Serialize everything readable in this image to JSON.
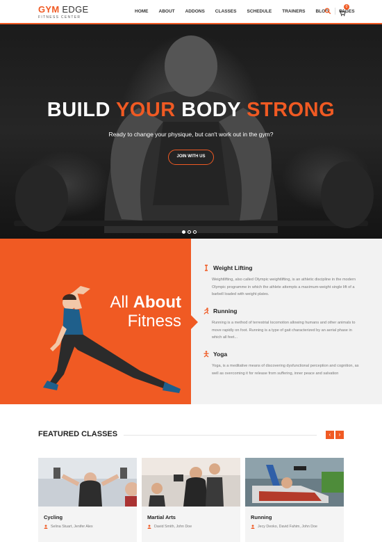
{
  "header": {
    "logo_accent": "GYM",
    "logo_rest": " EDGE",
    "logo_sub": "FITNESS CENTER",
    "nav": [
      "HOME",
      "ABOUT",
      "ADDONS",
      "CLASSES",
      "SCHEDULE",
      "TRAINERS",
      "BLOG",
      "PAGES"
    ],
    "cart_count": "0"
  },
  "hero": {
    "title_word1": "BUILD ",
    "title_word2": "YOUR",
    "title_word3": " BODY ",
    "title_word4": "STRONG",
    "subtitle": "Ready to change your physique, but can't work out in the gym?",
    "button": "JOIN WITH US",
    "slides": 3,
    "active_slide": 1
  },
  "about": {
    "heading_light": "All ",
    "heading_bold": "About",
    "heading_line2": "Fitness",
    "features": [
      {
        "icon": "dumbbell-icon",
        "title": "Weight Lifting",
        "text": "Weightlifting, also called Olympic weightlifting, is an athletic discipline in the modern Olympic programme in which the athlete attempts a maximum-weight single lift of a barbell loaded with weight plates."
      },
      {
        "icon": "runner-icon",
        "title": "Running",
        "text": "Running is a method of terrestrial locomotion allowing humans and other animals to move rapidly on foot. Running is a type of gait characterized by an aerial phase in which all feet..."
      },
      {
        "icon": "yoga-icon",
        "title": "Yoga",
        "text": "Yoga, is a meditative means of discovering dysfunctional perception and cognition, as well as overcoming it for release from suffering, inner peace and salvation"
      }
    ]
  },
  "featured": {
    "title": "FEATURED CLASSES",
    "prev": "‹",
    "next": "›",
    "cards": [
      {
        "title": "Cycling",
        "trainers": "Selina Stuart, Jenifer Alex"
      },
      {
        "title": "Martial Arts",
        "trainers": "David Smith, John Doe"
      },
      {
        "title": "Running",
        "trainers": "Jecy Deoko, David Fahim, John Doe"
      }
    ]
  },
  "colors": {
    "accent": "#f05a23",
    "dark": "#222222",
    "light_bg": "#f2f2f2"
  }
}
